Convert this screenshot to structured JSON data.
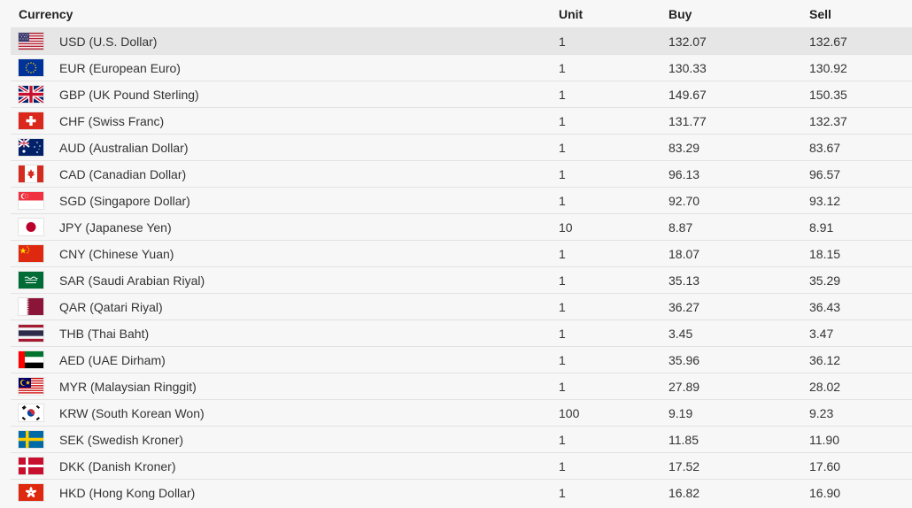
{
  "table": {
    "headers": {
      "currency": "Currency",
      "unit": "Unit",
      "buy": "Buy",
      "sell": "Sell"
    },
    "rows": [
      {
        "code": "us",
        "flag_icon": "us-flag-icon",
        "name": "USD (U.S. Dollar)",
        "unit": "1",
        "buy": "132.07",
        "sell": "132.67",
        "highlight": true
      },
      {
        "code": "eu",
        "flag_icon": "eu-flag-icon",
        "name": "EUR (European Euro)",
        "unit": "1",
        "buy": "130.33",
        "sell": "130.92"
      },
      {
        "code": "gb",
        "flag_icon": "gb-flag-icon",
        "name": "GBP (UK Pound Sterling)",
        "unit": "1",
        "buy": "149.67",
        "sell": "150.35"
      },
      {
        "code": "ch",
        "flag_icon": "ch-flag-icon",
        "name": "CHF (Swiss Franc)",
        "unit": "1",
        "buy": "131.77",
        "sell": "132.37"
      },
      {
        "code": "au",
        "flag_icon": "au-flag-icon",
        "name": "AUD (Australian Dollar)",
        "unit": "1",
        "buy": "83.29",
        "sell": "83.67"
      },
      {
        "code": "ca",
        "flag_icon": "ca-flag-icon",
        "name": "CAD (Canadian Dollar)",
        "unit": "1",
        "buy": "96.13",
        "sell": "96.57"
      },
      {
        "code": "sg",
        "flag_icon": "sg-flag-icon",
        "name": "SGD (Singapore Dollar)",
        "unit": "1",
        "buy": "92.70",
        "sell": "93.12"
      },
      {
        "code": "jp",
        "flag_icon": "jp-flag-icon",
        "name": "JPY (Japanese Yen)",
        "unit": "10",
        "buy": "8.87",
        "sell": "8.91"
      },
      {
        "code": "cn",
        "flag_icon": "cn-flag-icon",
        "name": "CNY (Chinese Yuan)",
        "unit": "1",
        "buy": "18.07",
        "sell": "18.15"
      },
      {
        "code": "sa",
        "flag_icon": "sa-flag-icon",
        "name": "SAR (Saudi Arabian Riyal)",
        "unit": "1",
        "buy": "35.13",
        "sell": "35.29"
      },
      {
        "code": "qa",
        "flag_icon": "qa-flag-icon",
        "name": "QAR (Qatari Riyal)",
        "unit": "1",
        "buy": "36.27",
        "sell": "36.43"
      },
      {
        "code": "th",
        "flag_icon": "th-flag-icon",
        "name": "THB (Thai Baht)",
        "unit": "1",
        "buy": "3.45",
        "sell": "3.47"
      },
      {
        "code": "ae",
        "flag_icon": "ae-flag-icon",
        "name": "AED (UAE Dirham)",
        "unit": "1",
        "buy": "35.96",
        "sell": "36.12"
      },
      {
        "code": "my",
        "flag_icon": "my-flag-icon",
        "name": "MYR (Malaysian Ringgit)",
        "unit": "1",
        "buy": "27.89",
        "sell": "28.02"
      },
      {
        "code": "kr",
        "flag_icon": "kr-flag-icon",
        "name": "KRW (South Korean Won)",
        "unit": "100",
        "buy": "9.19",
        "sell": "9.23"
      },
      {
        "code": "se",
        "flag_icon": "se-flag-icon",
        "name": "SEK (Swedish Kroner)",
        "unit": "1",
        "buy": "11.85",
        "sell": "11.90"
      },
      {
        "code": "dk",
        "flag_icon": "dk-flag-icon",
        "name": "DKK (Danish Kroner)",
        "unit": "1",
        "buy": "17.52",
        "sell": "17.60"
      },
      {
        "code": "hk",
        "flag_icon": "hk-flag-icon",
        "name": "HKD (Hong Kong Dollar)",
        "unit": "1",
        "buy": "16.82",
        "sell": "16.90"
      }
    ]
  },
  "colors": {
    "highlight_row": "#e6e6e6",
    "row_border": "#e2e2e2",
    "background": "#f7f7f7"
  }
}
